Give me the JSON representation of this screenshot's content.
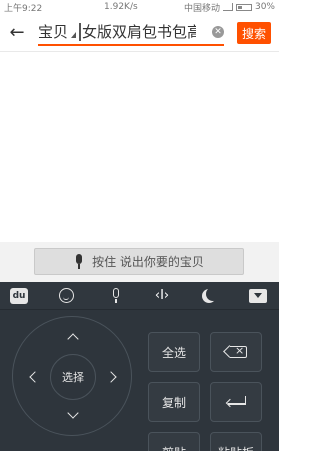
{
  "status_bar": {
    "time": "上午9:22",
    "network_speed": "1.92K/s",
    "carrier": "中国移动",
    "battery": "30%"
  },
  "search": {
    "query_part1": "宝贝",
    "query_part2": "女版双肩包书包高",
    "clear_icon": "clear-circle-icon",
    "search_button": "搜索",
    "accent_color": "#ff5000"
  },
  "voice": {
    "hint": "按住 说出你要的宝贝"
  },
  "keyboard": {
    "toolbar_icons": [
      "du-logo-icon",
      "emoji-icon",
      "microphone-icon",
      "cursor-move-icon",
      "night-mode-icon",
      "hide-keyboard-icon"
    ],
    "toolbar_du": "du",
    "dpad_center": "选择",
    "keys": {
      "select_all": "全选",
      "copy": "复制",
      "cut": "剪贴",
      "paste": "粘贴板"
    }
  }
}
